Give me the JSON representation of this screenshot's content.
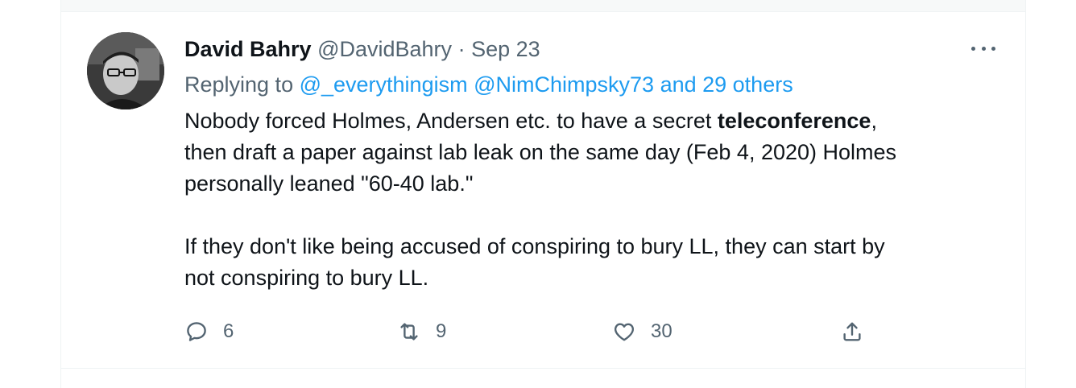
{
  "tweet": {
    "author_name": "David Bahry",
    "author_handle": "@DavidBahry",
    "separator": "·",
    "date": "Sep 23",
    "replying_prefix": "Replying to ",
    "reply_targets": [
      "@_everythingism",
      "@NimChimpsky73",
      "and 29 others"
    ],
    "text": {
      "line1_before": "Nobody forced Holmes, Andersen etc. to have a secret ",
      "line1_bold": "teleconference",
      "line1_after": ",",
      "line2": "then draft a paper against lab leak on the same day (Feb 4, 2020) Holmes",
      "line3": "personally leaned \"60-40 lab.\"",
      "line4": "If they don't like being accused of conspiring to bury LL, they can start by",
      "line5": "not conspiring to bury LL."
    },
    "stats": {
      "replies": "6",
      "retweets": "9",
      "likes": "30"
    }
  },
  "icons": {
    "more": "more-horizontal-icon",
    "reply": "reply-bubble-icon",
    "retweet": "retweet-icon",
    "like": "heart-icon",
    "share": "share-upload-icon"
  },
  "colors": {
    "text": "#0f1419",
    "secondary": "#536471",
    "link": "#1d9bf0",
    "border": "#eff3f4"
  }
}
